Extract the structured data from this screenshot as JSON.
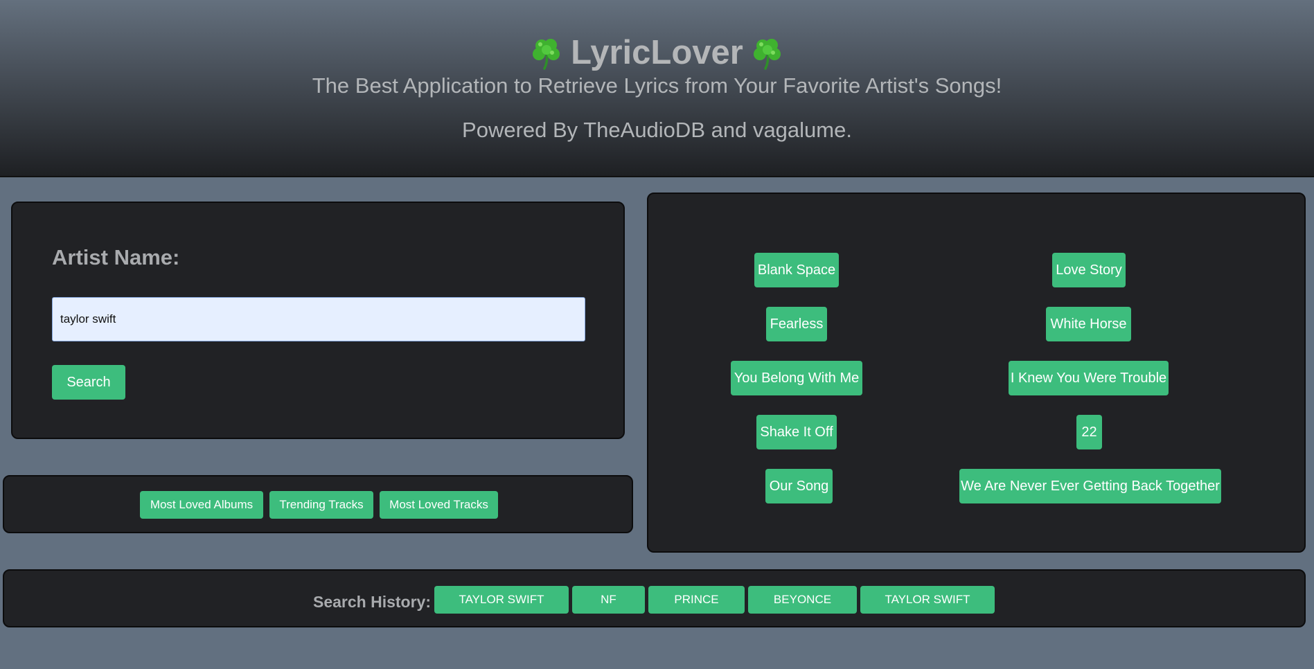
{
  "header": {
    "title": "LyricLover",
    "clover_icon": "shamrock-icon",
    "subtitle": "The Best Application to Retrieve Lyrics from Your Favorite Artist's Songs!",
    "powered_by": "Powered By TheAudioDB and vagalume."
  },
  "search": {
    "label": "Artist Name:",
    "value": "taylor swift",
    "button": "Search"
  },
  "links": [
    "Most Loved Albums",
    "Trending Tracks",
    "Most Loved Tracks"
  ],
  "songs": [
    "Blank Space",
    "Love Story",
    "Fearless",
    "White Horse",
    "You Belong With Me",
    "I Knew You Were Trouble",
    "Shake It Off",
    "22",
    "Our Song",
    "We Are Never Ever Getting Back Together"
  ],
  "history": {
    "label": "Search History:",
    "items": [
      "TAYLOR SWIFT",
      "NF",
      "PRINCE",
      "BEYONCE",
      "TAYLOR SWIFT"
    ]
  },
  "colors": {
    "background": "#627080",
    "panel": "#212225",
    "button": "#3dbd7d",
    "text_muted": "#b3b6b9"
  }
}
